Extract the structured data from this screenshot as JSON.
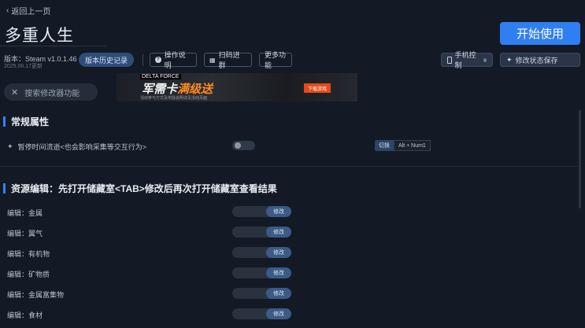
{
  "nav": {
    "back_label": "返回上一页"
  },
  "game": {
    "title": "多重人生",
    "version": "版本：Steam v1.0.1.46",
    "date": "2025.06.17更新"
  },
  "buttons": {
    "start": "开始使用",
    "history": "版本历史记录",
    "instructions": "操作说明",
    "scan": "扫码进群",
    "more": "更多功能",
    "phone": "手机控制",
    "save_state": "修改状态保存"
  },
  "search": {
    "placeholder": "搜索修改器功能"
  },
  "banner": {
    "top_text": "DELTA FORCE",
    "headline_a": "军需卡",
    "headline_b": "满级送",
    "sub_text": "活动参与方式及奖励说明详见活动页面",
    "button": "下载游戏"
  },
  "sections": [
    {
      "title": "常规属性",
      "rows": [
        {
          "label": "暂停时间流逝<也会影响采集等交互行为>",
          "switch": "切换",
          "hotkey": "Alt + Num1"
        }
      ]
    },
    {
      "title": "资源编辑：先打开储藏室<TAB>修改后再次打开储藏室查看结果",
      "rows": [
        {
          "label": "编辑：金属",
          "button": "修改"
        },
        {
          "label": "编辑：翼气",
          "button": "修改"
        },
        {
          "label": "编辑：有机物",
          "button": "修改"
        },
        {
          "label": "编辑：矿物质",
          "button": "修改"
        },
        {
          "label": "编辑：金属富集物",
          "button": "修改"
        },
        {
          "label": "编辑：食材",
          "button": "修改"
        }
      ]
    }
  ],
  "colors": {
    "accent": "#2f7ff2",
    "background": "#131a25",
    "section_bar": "#3a7ef0"
  }
}
